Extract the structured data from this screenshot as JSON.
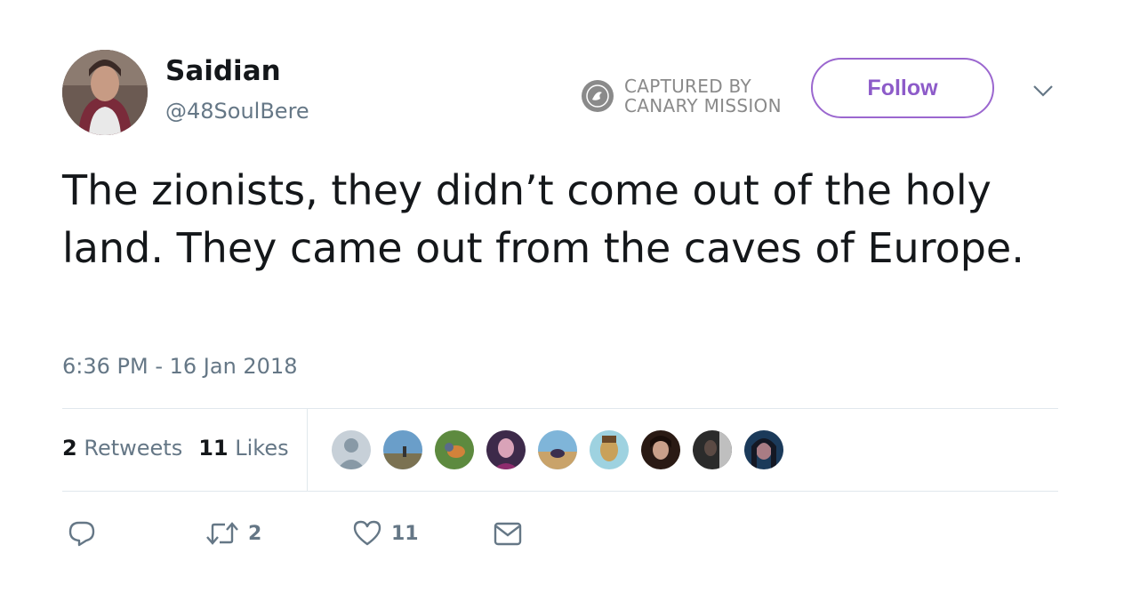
{
  "user": {
    "name": "Saidian",
    "handle": "@48SoulBere"
  },
  "stamp": {
    "line1": "CAPTURED BY",
    "line2": "CANARY MISSION"
  },
  "follow_label": "Follow",
  "tweet_text": "The zionists, they didn’t come out of the holy land. They came out from the caves of Europe.",
  "timestamp": "6:36 PM - 16 Jan 2018",
  "stats": {
    "retweets_count": "2",
    "retweets_label": "Retweets",
    "likes_count": "11",
    "likes_label": "Likes"
  },
  "actions": {
    "retweet_count": "2",
    "like_count": "11"
  },
  "colors": {
    "follow_accent": "#9b67cf",
    "secondary_text": "#657786",
    "divider": "#e1e8ed"
  },
  "icons": [
    "reply-icon",
    "retweet-icon",
    "like-icon",
    "message-icon",
    "caret-down-icon",
    "canary-logo-icon"
  ]
}
